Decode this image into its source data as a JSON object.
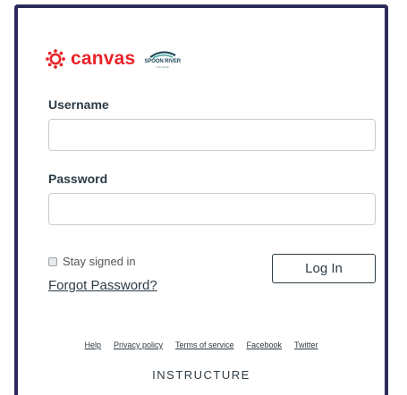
{
  "brand": {
    "canvas_word": "canvas",
    "canvas_icon": "canvas-logo-icon",
    "college_logo_text": "SPOON RIVER",
    "college_logo_subtext": "COLLEGE",
    "accent_color": "#e72429",
    "frame_color": "#2d2b5c"
  },
  "form": {
    "username_label": "Username",
    "username_value": "",
    "password_label": "Password",
    "password_value": "",
    "stay_signed_in_label": "Stay signed in",
    "stay_signed_in_checked": false,
    "forgot_password": "Forgot Password?",
    "login_button": "Log In"
  },
  "footer": {
    "links": [
      "Help",
      "Privacy policy",
      "Terms of service",
      "Facebook",
      "Twitter"
    ],
    "brand": "INSTRUCTURE"
  }
}
